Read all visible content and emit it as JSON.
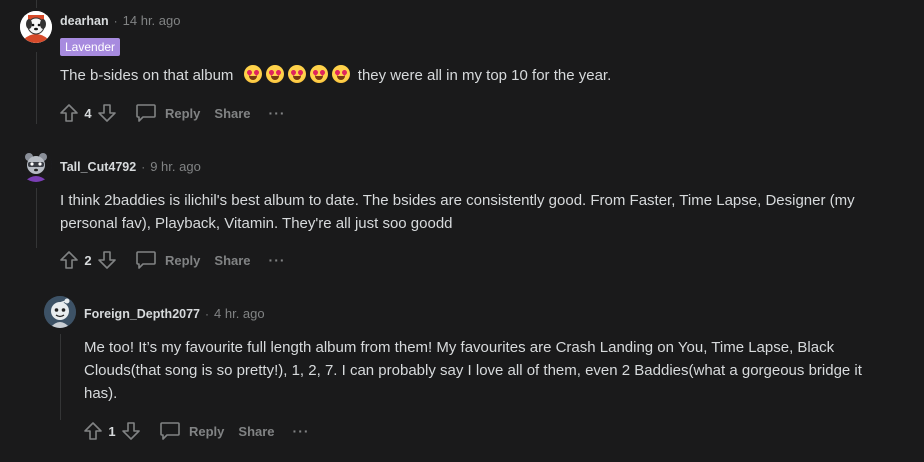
{
  "comments": [
    {
      "author": "dearhan",
      "time": "14 hr. ago",
      "flair": "Lavender",
      "body_before": "The b-sides on that album",
      "emoji_name": "star-struck-emoji",
      "emoji_count": 5,
      "body_after": "they were all in my top 10 for the year.",
      "score": "4",
      "reply_label": "Reply",
      "share_label": "Share",
      "more_label": "···"
    },
    {
      "author": "Tall_Cut4792",
      "time": "9 hr. ago",
      "body": "I think 2baddies is ilichil's best album to date. The bsides are consistently good. From Faster, Time Lapse, Designer (my personal fav), Playback, Vitamin. They're all just soo goodd",
      "score": "2",
      "reply_label": "Reply",
      "share_label": "Share",
      "more_label": "···"
    },
    {
      "author": "Foreign_Depth2077",
      "time": "4 hr. ago",
      "body": "Me too! It’s my favourite full length album from them! My favourites are Crash Landing on You, Time Lapse, Black Clouds(that song is so pretty!), 1, 2, 7. I can probably say I love all of them, even 2 Baddies(what a gorgeous bridge it has).",
      "score": "1",
      "reply_label": "Reply",
      "share_label": "Share",
      "more_label": "···"
    }
  ],
  "separator": "·",
  "colors": {
    "background": "#1a1a1b",
    "text": "#d7dadc",
    "muted": "#818384",
    "flair": "#a78bdf",
    "thread_line": "#343536"
  },
  "icons": [
    "upvote-icon",
    "downvote-icon",
    "reply-bubble-icon",
    "more-options-icon"
  ]
}
